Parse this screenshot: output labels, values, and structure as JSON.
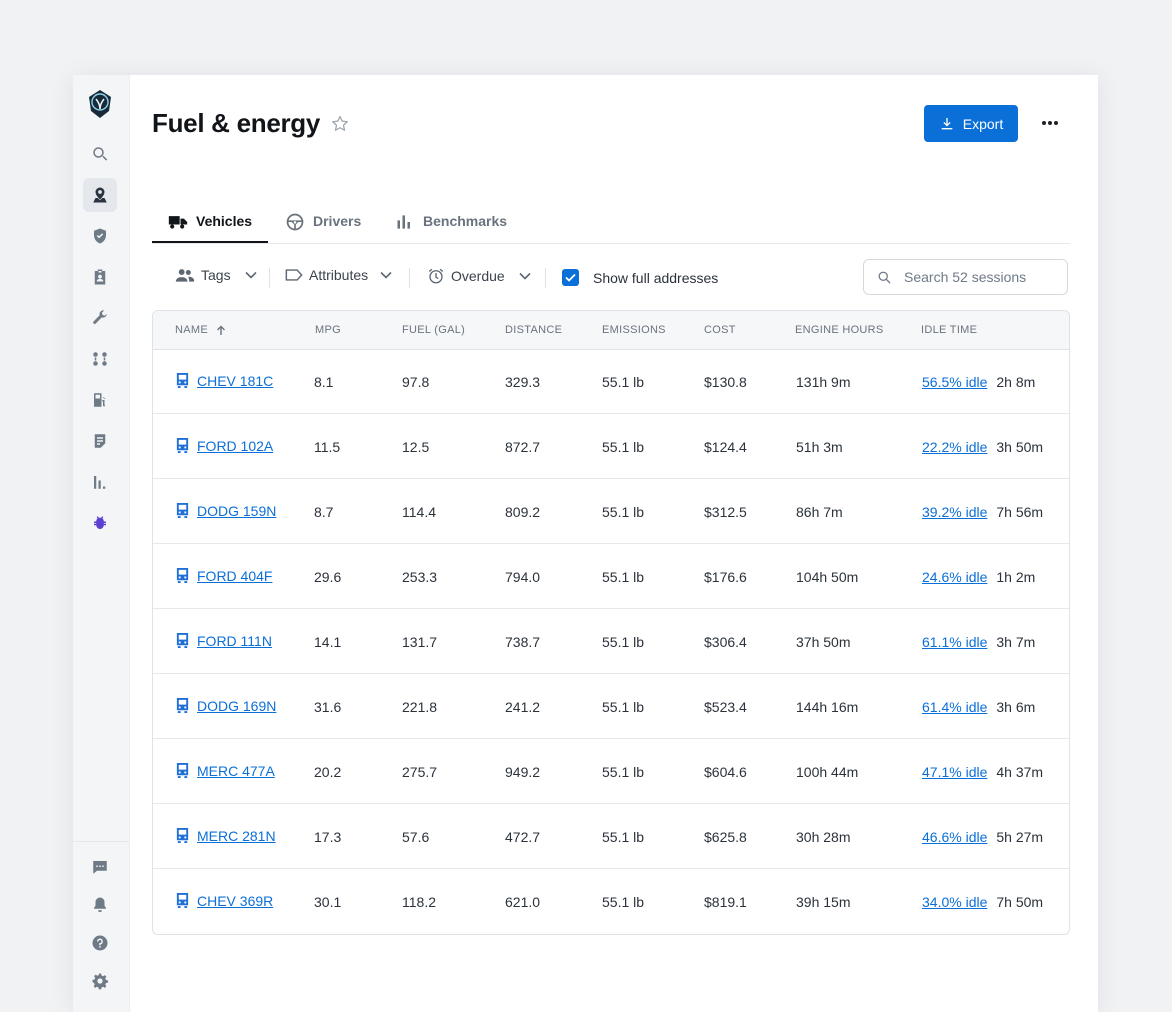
{
  "page": {
    "title": "Fuel & energy",
    "export_label": "Export"
  },
  "sidebar": {
    "icons": [
      "logo-icon",
      "search-icon",
      "map-pin-icon",
      "shield-icon",
      "clipboard-icon",
      "wrench-icon",
      "route-icon",
      "fuel-pump-icon",
      "document-icon",
      "bar-chart-icon",
      "bug-icon",
      "chat-icon",
      "bell-icon",
      "help-icon",
      "gear-icon"
    ],
    "active": "map-pin-icon"
  },
  "tabs": [
    {
      "label": "Vehicles",
      "icon": "truck-icon",
      "active": true
    },
    {
      "label": "Drivers",
      "icon": "steering-wheel-icon",
      "active": false
    },
    {
      "label": "Benchmarks",
      "icon": "bar-chart-icon",
      "active": false
    }
  ],
  "filters": {
    "tags": "Tags",
    "attributes": "Attributes",
    "overdue": "Overdue",
    "show_full_addresses": "Show full addresses",
    "show_full_addresses_checked": true
  },
  "search": {
    "placeholder": "Search 52 sessions"
  },
  "table": {
    "columns": [
      "Name",
      "MPG",
      "Fuel (gal)",
      "Distance",
      "Emissions",
      "Cost",
      "Engine hours",
      "Idle time"
    ],
    "sort_column": "Name",
    "rows": [
      {
        "name": "CHEV 181C",
        "mpg": "8.1",
        "fuel": "97.8",
        "distance": "329.3",
        "emissions": "55.1 lb",
        "cost": "$130.8",
        "engine_hours": "131h 9m",
        "idle_pct": "56.5% idle",
        "idle_time": "2h 8m"
      },
      {
        "name": "FORD 102A",
        "mpg": "11.5",
        "fuel": "12.5",
        "distance": "872.7",
        "emissions": "55.1 lb",
        "cost": "$124.4",
        "engine_hours": "51h 3m",
        "idle_pct": "22.2% idle",
        "idle_time": "3h 50m"
      },
      {
        "name": "DODG 159N",
        "mpg": "8.7",
        "fuel": "114.4",
        "distance": "809.2",
        "emissions": "55.1 lb",
        "cost": "$312.5",
        "engine_hours": "86h 7m",
        "idle_pct": "39.2% idle",
        "idle_time": "7h 56m"
      },
      {
        "name": "FORD 404F",
        "mpg": "29.6",
        "fuel": "253.3",
        "distance": "794.0",
        "emissions": "55.1 lb",
        "cost": "$176.6",
        "engine_hours": "104h 50m",
        "idle_pct": "24.6% idle",
        "idle_time": "1h 2m"
      },
      {
        "name": "FORD 111N",
        "mpg": "14.1",
        "fuel": "131.7",
        "distance": "738.7",
        "emissions": "55.1 lb",
        "cost": "$306.4",
        "engine_hours": "37h 50m",
        "idle_pct": "61.1% idle",
        "idle_time": "3h 7m"
      },
      {
        "name": "DODG 169N",
        "mpg": "31.6",
        "fuel": "221.8",
        "distance": "241.2",
        "emissions": "55.1 lb",
        "cost": "$523.4",
        "engine_hours": "144h 16m",
        "idle_pct": "61.4% idle",
        "idle_time": "3h 6m"
      },
      {
        "name": "MERC 477A",
        "mpg": "20.2",
        "fuel": "275.7",
        "distance": "949.2",
        "emissions": "55.1 lb",
        "cost": "$604.6",
        "engine_hours": "100h 44m",
        "idle_pct": "47.1% idle",
        "idle_time": "4h 37m"
      },
      {
        "name": "MERC 281N",
        "mpg": "17.3",
        "fuel": "57.6",
        "distance": "472.7",
        "emissions": "55.1 lb",
        "cost": "$625.8",
        "engine_hours": "30h 28m",
        "idle_pct": "46.6% idle",
        "idle_time": "5h 27m"
      },
      {
        "name": "CHEV 369R",
        "mpg": "30.1",
        "fuel": "118.2",
        "distance": "621.0",
        "emissions": "55.1 lb",
        "cost": "$819.1",
        "engine_hours": "39h 15m",
        "idle_pct": "34.0% idle",
        "idle_time": "7h 50m"
      }
    ]
  },
  "colors": {
    "accent": "#0b6fd8",
    "sidebar_bg": "#f4f5f7",
    "page_bg": "#f1f2f4"
  }
}
